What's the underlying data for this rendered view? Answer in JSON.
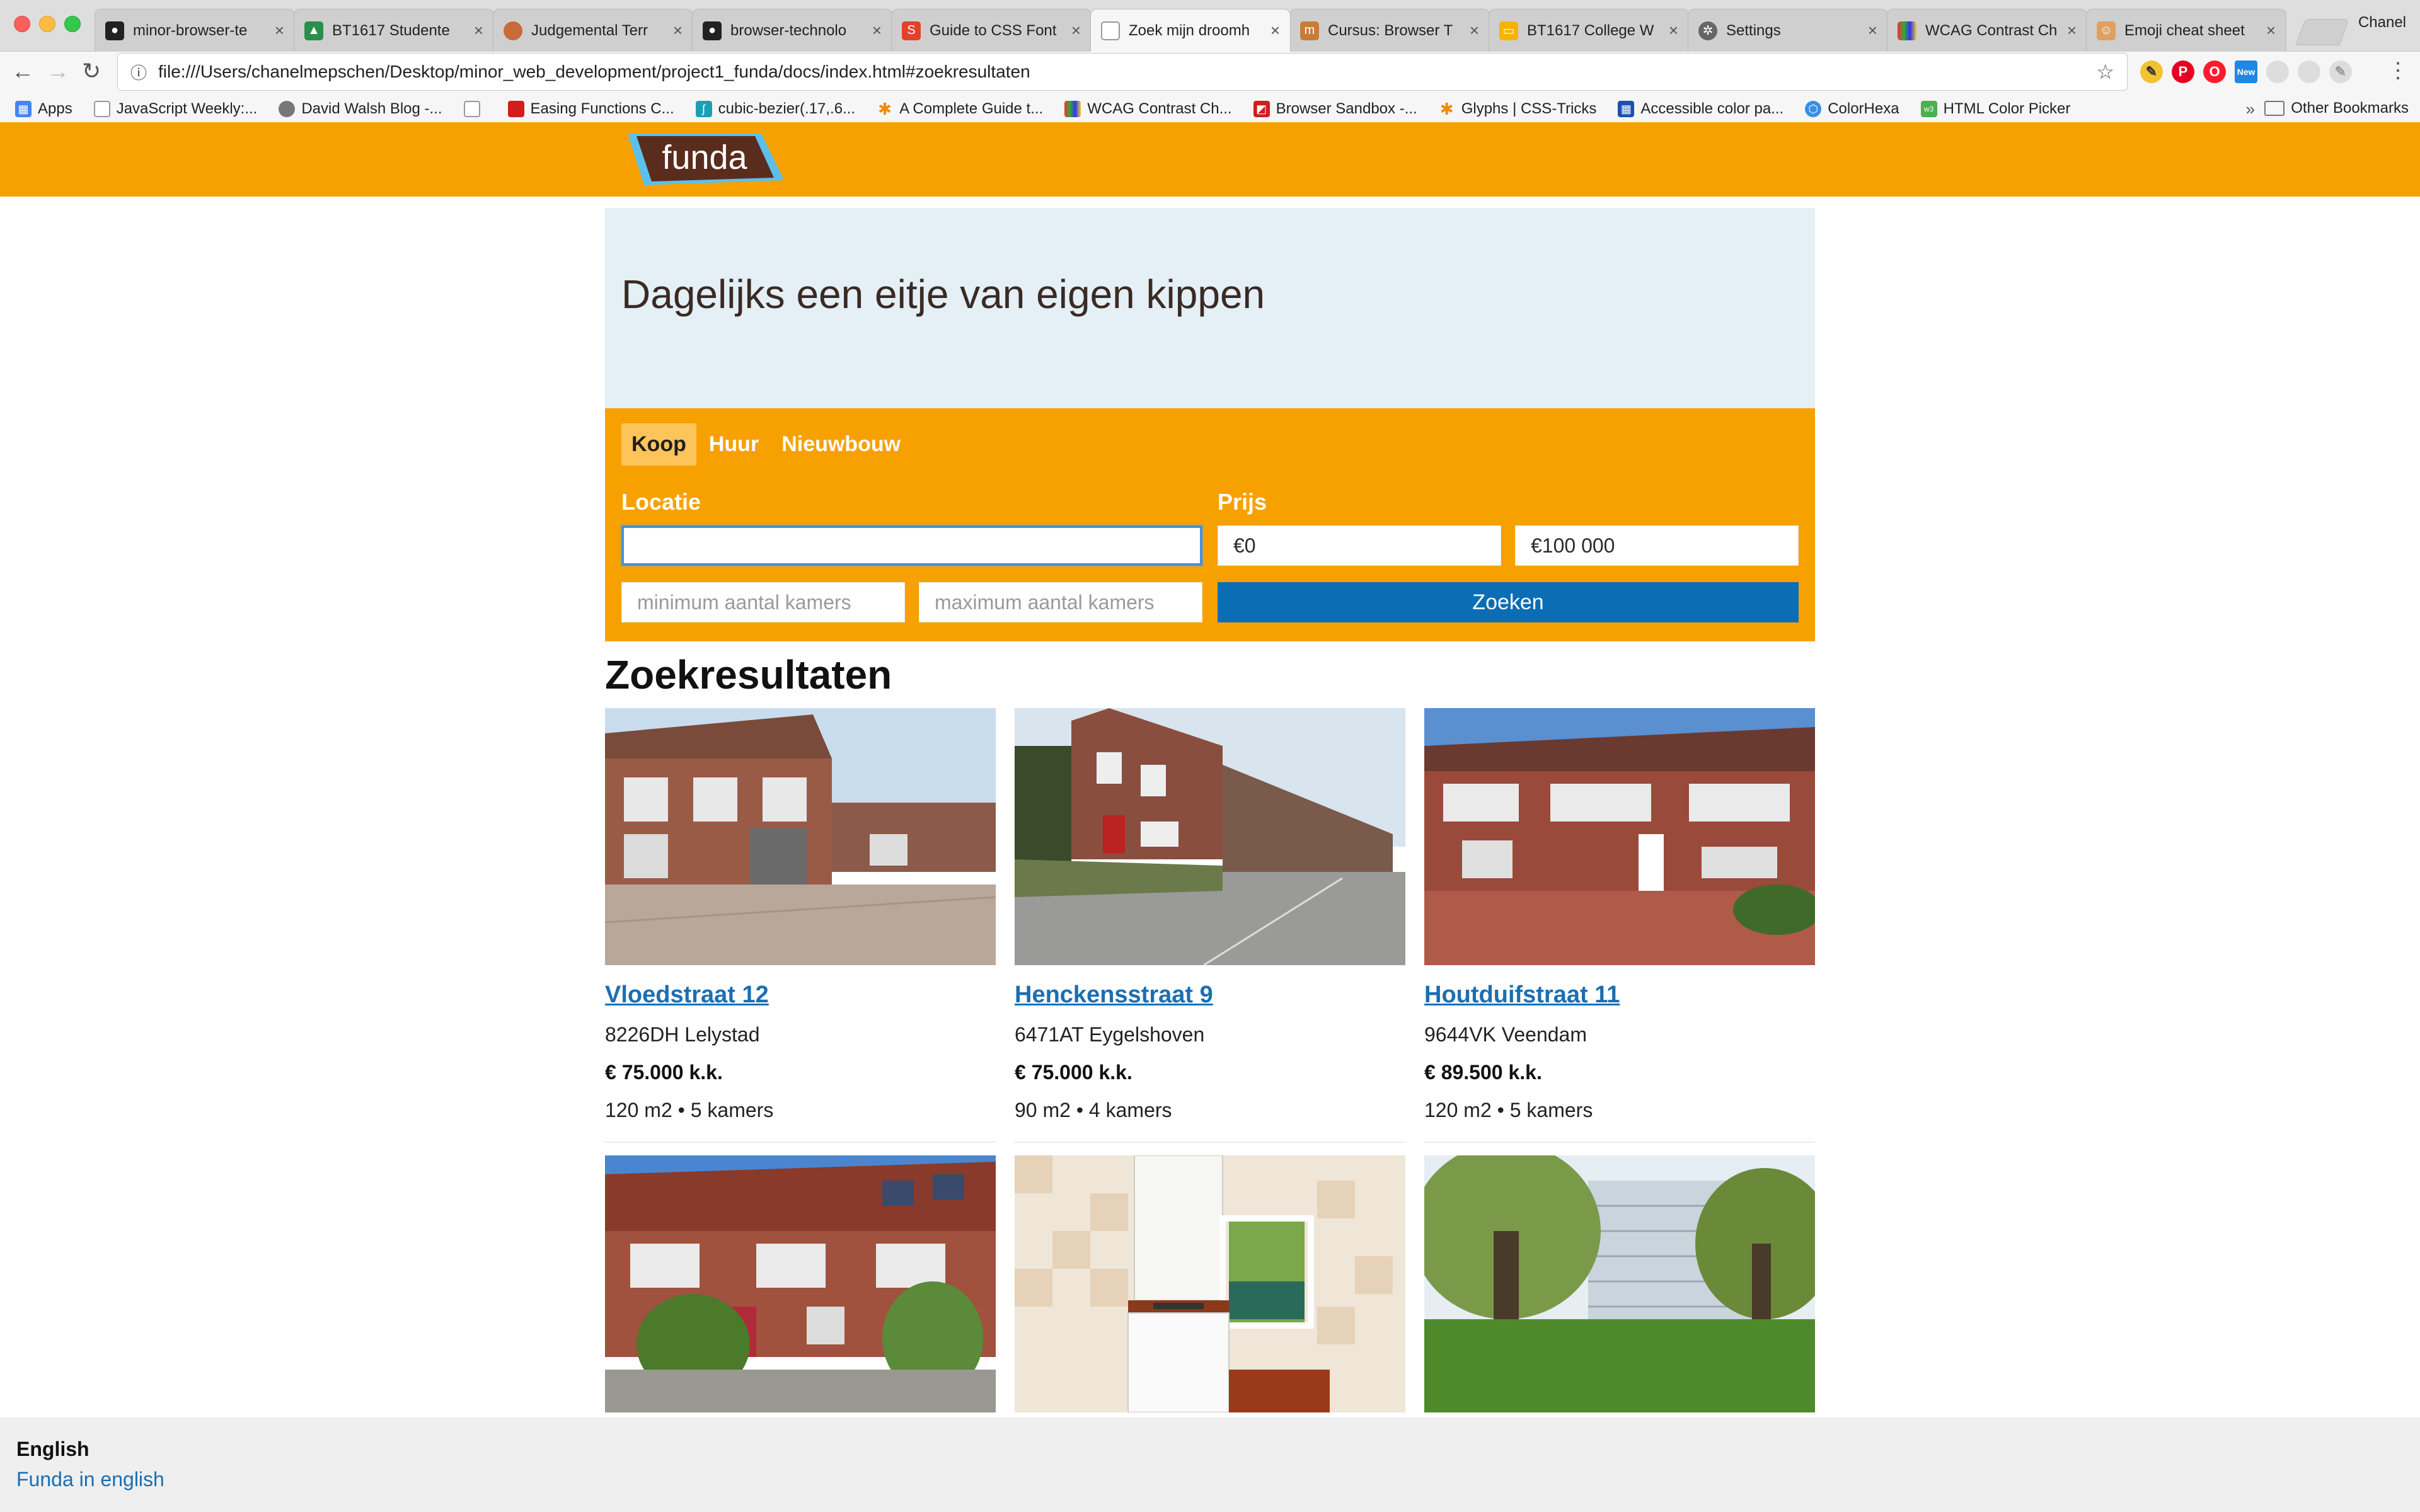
{
  "browser": {
    "tabs": [
      {
        "title": "minor-browser-te",
        "icon": "github-icon",
        "color": "#222222"
      },
      {
        "title": "BT1617 Studente",
        "icon": "google-drive-icon",
        "color": "#2a8f4a"
      },
      {
        "title": "Judgemental Terr",
        "icon": "avatar-icon",
        "color": "#c96a3a"
      },
      {
        "title": "browser-technolo",
        "icon": "github-icon",
        "color": "#222222"
      },
      {
        "title": "Guide to CSS Font",
        "icon": "smashing-icon",
        "color": "#e3412c"
      },
      {
        "title": "Zoek mijn droomh",
        "icon": "document-icon",
        "color": "#9e9e9e"
      },
      {
        "title": "Cursus: Browser T",
        "icon": "school-icon",
        "color": "#c77d3a"
      },
      {
        "title": "BT1617 College W",
        "icon": "slides-icon",
        "color": "#f4b400"
      },
      {
        "title": "Settings",
        "icon": "gear-icon",
        "color": "#666666"
      },
      {
        "title": "WCAG Contrast Ch",
        "icon": "palette-icon",
        "color": "#7b4ab3"
      },
      {
        "title": "Emoji cheat sheet",
        "icon": "emoji-icon",
        "color": "#e0a060"
      }
    ],
    "active_tab": 5,
    "profile": "Chanel",
    "url": "file:///Users/chanelmepschen/Desktop/minor_web_development/project1_funda/docs/index.html#zoekresultaten",
    "bookmarks": [
      {
        "label": "Apps",
        "icon": "apps-grid-icon",
        "color": "#4285f4"
      },
      {
        "label": "JavaScript Weekly:...",
        "icon": "document-icon",
        "color": "#9e9e9e"
      },
      {
        "label": "David Walsh Blog -...",
        "icon": "avatar-icon",
        "color": "#777777"
      },
      {
        "label": "",
        "icon": "document-icon",
        "color": "#9e9e9e"
      },
      {
        "label": "Easing Functions C...",
        "icon": "bookmark-icon",
        "color": "#d11d1d"
      },
      {
        "label": "cubic-bezier(.17,.6...",
        "icon": "curve-icon",
        "color": "#1aa0b5"
      },
      {
        "label": "A Complete Guide t...",
        "icon": "star-icon",
        "color": "#f08a00"
      },
      {
        "label": "WCAG Contrast Ch...",
        "icon": "palette-icon",
        "color": "#7b4ab3"
      },
      {
        "label": "Browser Sandbox -...",
        "icon": "sandbox-icon",
        "color": "#d11d1d"
      },
      {
        "label": "Glyphs | CSS-Tricks",
        "icon": "star-icon",
        "color": "#f08a00"
      },
      {
        "label": "Accessible color pa...",
        "icon": "color-grid-icon",
        "color": "#1a4fb3"
      },
      {
        "label": "ColorHexa",
        "icon": "hexagon-icon",
        "color": "#3a8ee6"
      },
      {
        "label": "HTML Color Picker",
        "icon": "w3-icon",
        "color": "#4caf50"
      }
    ],
    "other_bookmarks": "Other Bookmarks",
    "more_chevron": "»"
  },
  "site": {
    "logo_text": "funda",
    "colors": {
      "brand_orange": "#f7a100",
      "brand_brown": "#5a2c1d",
      "brand_blue": "#5bc0eb",
      "link_blue": "#1a6fb3",
      "button_blue": "#0b6eb5"
    },
    "hero_title": "Dagelijks een eitje van eigen kippen",
    "search": {
      "tabs": [
        "Koop",
        "Huur",
        "Nieuwbouw"
      ],
      "active_tab": 0,
      "location_label": "Locatie",
      "location_value": "",
      "price_label": "Prijs",
      "price_min": "€0",
      "price_max": "€100 000",
      "rooms_min_placeholder": "minimum aantal kamers",
      "rooms_max_placeholder": "maximum aantal kamers",
      "submit_label": "Zoeken"
    },
    "results_title": "Zoekresultaten",
    "results": [
      {
        "address": "Vloedstraat 12",
        "city": "8226DH Lelystad",
        "price": "€ 75.000 k.k.",
        "specs": "120 m2 • 5 kamers",
        "photo": "rowhouse-street"
      },
      {
        "address": "Henckensstraat 9",
        "city": "6471AT Eygelshoven",
        "price": "€ 75.000 k.k.",
        "specs": "90 m2 • 4 kamers",
        "photo": "hill-street"
      },
      {
        "address": "Houtduifstraat 11",
        "city": "9644VK Veendam",
        "price": "€ 89.500 k.k.",
        "specs": "120 m2 • 5 kamers",
        "photo": "brick-terrace"
      },
      {
        "address": "",
        "city": "",
        "price": "",
        "specs": "",
        "photo": "rowhouse-garden"
      },
      {
        "address": "",
        "city": "",
        "price": "",
        "specs": "",
        "photo": "kitchen"
      },
      {
        "address": "",
        "city": "",
        "price": "",
        "specs": "",
        "photo": "park-flat"
      }
    ],
    "footer": {
      "heading": "English",
      "link": "Funda in english"
    }
  }
}
